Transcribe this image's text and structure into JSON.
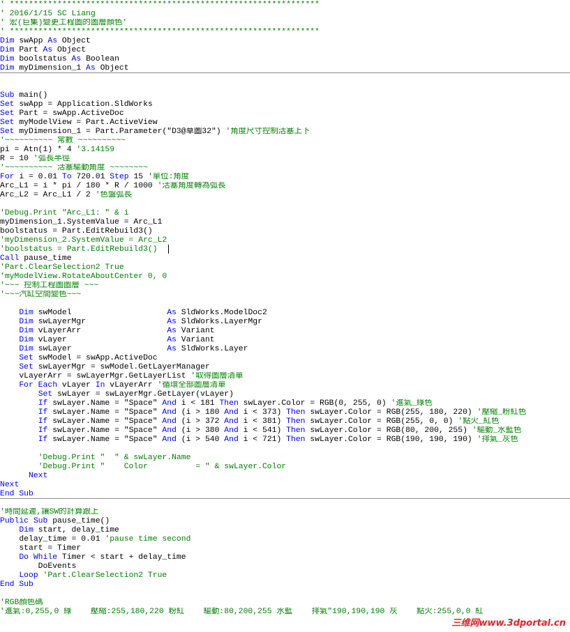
{
  "colors": {
    "keyword": "#0000ff",
    "comment": "#008000",
    "text": "#000000",
    "separator": "#8c8c8c",
    "watermark": "#e0262b"
  },
  "watermark": "三维网www.3dportal.cn",
  "lines": [
    [
      [
        "c",
        "' *****************************************************************"
      ]
    ],
    [
      [
        "c",
        "' 2016/1/15 SC Liang"
      ]
    ],
    [
      [
        "c",
        "' 宏(巨集)變更工程圖的圖層顏色'"
      ]
    ],
    [
      [
        "c",
        "' *****************************************************************"
      ]
    ],
    [
      [
        "k",
        "Dim "
      ],
      [
        "t",
        "swApp "
      ],
      [
        "k",
        "As "
      ],
      [
        "t",
        "Object"
      ]
    ],
    [
      [
        "k",
        "Dim "
      ],
      [
        "t",
        "Part "
      ],
      [
        "k",
        "As "
      ],
      [
        "t",
        "Object"
      ]
    ],
    [
      [
        "k",
        "Dim "
      ],
      [
        "t",
        "boolstatus "
      ],
      [
        "k",
        "As "
      ],
      [
        "t",
        "Boolean"
      ]
    ],
    [
      [
        "k",
        "Dim "
      ],
      [
        "t",
        "myDimension_1 "
      ],
      [
        "k",
        "As "
      ],
      [
        "t",
        "Object"
      ]
    ],
    [],
    [],
    [
      [
        "k",
        "Sub "
      ],
      [
        "t",
        "main()"
      ]
    ],
    [
      [
        "k",
        "Set "
      ],
      [
        "t",
        "swApp = Application.SldWorks"
      ]
    ],
    [
      [
        "k",
        "Set "
      ],
      [
        "t",
        "Part = swApp.ActiveDoc"
      ]
    ],
    [
      [
        "k",
        "Set "
      ],
      [
        "t",
        "myModelView = Part.ActiveView"
      ]
    ],
    [
      [
        "k",
        "Set "
      ],
      [
        "t",
        "myDimension_1 = Part.Parameter(\"D3@草圖32\") "
      ],
      [
        "c",
        "'角度尺寸控制活塞上下"
      ]
    ],
    [
      [
        "c",
        "'~~~~~~~~~~ 常數 ~~~~~~~~~~"
      ]
    ],
    [
      [
        "t",
        "pi = Atn(1) * 4 "
      ],
      [
        "c",
        "'3.14159"
      ]
    ],
    [
      [
        "t",
        "R = 10 "
      ],
      [
        "c",
        "'弧長半徑"
      ]
    ],
    [
      [
        "c",
        "'~~~~~~~~~~ 活塞驅動角度 ~~~~~~~~"
      ]
    ],
    [
      [
        "k",
        "For "
      ],
      [
        "t",
        "i = 0.01 "
      ],
      [
        "k",
        "To "
      ],
      [
        "t",
        "720.01 "
      ],
      [
        "k",
        "Step "
      ],
      [
        "t",
        "15 "
      ],
      [
        "c",
        "'單位:角度"
      ]
    ],
    [
      [
        "t",
        "Arc_L1 = i * pi / 180 * R / 1000 "
      ],
      [
        "c",
        "'活塞角度轉為弧長"
      ]
    ],
    [
      [
        "t",
        "Arc_L2 = Arc_L1 / 2 "
      ],
      [
        "c",
        "'色盤弧長"
      ]
    ],
    [],
    [
      [
        "c",
        "'Debug.Print \"Arc_L1: \" & i"
      ]
    ],
    [
      [
        "t",
        "myDimension_1.SystemValue = Arc_L1"
      ]
    ],
    [
      [
        "t",
        "boolstatus = Part.EditRebuild3()"
      ]
    ],
    [
      [
        "c",
        "'myDimension_2.SystemValue = Arc_L2"
      ]
    ],
    [
      [
        "c",
        "'boolstatus = Part.EditRebuild3()"
      ]
    ],
    [
      [
        "k",
        "Call "
      ],
      [
        "t",
        "pause_time"
      ]
    ],
    [
      [
        "c",
        "'Part.ClearSelection2 True"
      ]
    ],
    [
      [
        "c",
        "'myModelView.RotateAboutCenter 0, 0"
      ]
    ],
    [
      [
        "c",
        "'~~~ 控制工程圖圖層 ~~~"
      ]
    ],
    [
      [
        "c",
        "'~~~汽缸空間變色~~~"
      ]
    ],
    [],
    [
      [
        "t",
        "    "
      ],
      [
        "k",
        "Dim "
      ],
      [
        "t",
        "swModel                    "
      ],
      [
        "k",
        "As "
      ],
      [
        "t",
        "SldWorks.ModelDoc2"
      ]
    ],
    [
      [
        "t",
        "    "
      ],
      [
        "k",
        "Dim "
      ],
      [
        "t",
        "swLayerMgr                 "
      ],
      [
        "k",
        "As "
      ],
      [
        "t",
        "SldWorks.LayerMgr"
      ]
    ],
    [
      [
        "t",
        "    "
      ],
      [
        "k",
        "Dim "
      ],
      [
        "t",
        "vLayerArr                  "
      ],
      [
        "k",
        "As "
      ],
      [
        "t",
        "Variant"
      ]
    ],
    [
      [
        "t",
        "    "
      ],
      [
        "k",
        "Dim "
      ],
      [
        "t",
        "vLayer                     "
      ],
      [
        "k",
        "As "
      ],
      [
        "t",
        "Variant"
      ]
    ],
    [
      [
        "t",
        "    "
      ],
      [
        "k",
        "Dim "
      ],
      [
        "t",
        "swLayer                    "
      ],
      [
        "k",
        "As "
      ],
      [
        "t",
        "SldWorks.Layer"
      ]
    ],
    [
      [
        "t",
        "    "
      ],
      [
        "k",
        "Set "
      ],
      [
        "t",
        "swModel = swApp.ActiveDoc"
      ]
    ],
    [
      [
        "t",
        "    "
      ],
      [
        "k",
        "Set "
      ],
      [
        "t",
        "swLayerMgr = swModel.GetLayerManager"
      ]
    ],
    [
      [
        "t",
        "    vLayerArr = swLayerMgr.GetLayerList "
      ],
      [
        "c",
        "'取得圖層清單"
      ]
    ],
    [
      [
        "t",
        "    "
      ],
      [
        "k",
        "For Each "
      ],
      [
        "t",
        "vLayer "
      ],
      [
        "k",
        "In "
      ],
      [
        "t",
        "vLayerArr "
      ],
      [
        "c",
        "'循環全部圖層清單"
      ]
    ],
    [
      [
        "t",
        "        "
      ],
      [
        "k",
        "Set "
      ],
      [
        "t",
        "swLayer = swLayerMgr.GetLayer(vLayer)"
      ]
    ],
    [
      [
        "t",
        "        "
      ],
      [
        "k",
        "If "
      ],
      [
        "t",
        "swLayer.Name = \"Space\" "
      ],
      [
        "k",
        "And "
      ],
      [
        "t",
        "i < 181 "
      ],
      [
        "k",
        "Then "
      ],
      [
        "t",
        "swLayer.Color = RGB(0, 255, 0) "
      ],
      [
        "c",
        "'進氣_綠色"
      ]
    ],
    [
      [
        "t",
        "        "
      ],
      [
        "k",
        "If "
      ],
      [
        "t",
        "swLayer.Name = \"Space\" "
      ],
      [
        "k",
        "And "
      ],
      [
        "t",
        "(i > 180 "
      ],
      [
        "k",
        "And "
      ],
      [
        "t",
        "i < 373) "
      ],
      [
        "k",
        "Then "
      ],
      [
        "t",
        "swLayer.Color = RGB(255, 180, 220) "
      ],
      [
        "c",
        "'壓縮_粉紅色"
      ]
    ],
    [
      [
        "t",
        "        "
      ],
      [
        "k",
        "If "
      ],
      [
        "t",
        "swLayer.Name = \"Space\" "
      ],
      [
        "k",
        "And "
      ],
      [
        "t",
        "(i > 372 "
      ],
      [
        "k",
        "And "
      ],
      [
        "t",
        "i < 381) "
      ],
      [
        "k",
        "Then "
      ],
      [
        "t",
        "swLayer.Color = RGB(255, 0, 0) "
      ],
      [
        "c",
        "'點火_紅色"
      ]
    ],
    [
      [
        "t",
        "        "
      ],
      [
        "k",
        "If "
      ],
      [
        "t",
        "swLayer.Name = \"Space\" "
      ],
      [
        "k",
        "And "
      ],
      [
        "t",
        "(i > 380 "
      ],
      [
        "k",
        "And "
      ],
      [
        "t",
        "i < 541) "
      ],
      [
        "k",
        "Then "
      ],
      [
        "t",
        "swLayer.Color = RGB(80, 200, 255) "
      ],
      [
        "c",
        "'驅動_水藍色"
      ]
    ],
    [
      [
        "t",
        "        "
      ],
      [
        "k",
        "If "
      ],
      [
        "t",
        "swLayer.Name = \"Space\" "
      ],
      [
        "k",
        "And "
      ],
      [
        "t",
        "(i > 540 "
      ],
      [
        "k",
        "And "
      ],
      [
        "t",
        "i < 721) "
      ],
      [
        "k",
        "Then "
      ],
      [
        "t",
        "swLayer.Color = RGB(190, 190, 190) "
      ],
      [
        "c",
        "'排氣_灰色"
      ]
    ],
    [],
    [
      [
        "t",
        "        "
      ],
      [
        "c",
        "'Debug.Print \"  \" & swLayer.Name"
      ]
    ],
    [
      [
        "t",
        "        "
      ],
      [
        "c",
        "'Debug.Print \"    Color          = \" & swLayer.Color"
      ]
    ],
    [
      [
        "t",
        "      "
      ],
      [
        "k",
        "Next"
      ]
    ],
    [
      [
        "k",
        "Next"
      ]
    ],
    [
      [
        "k",
        "End Sub"
      ]
    ],
    [],
    [
      [
        "c",
        "'時間延遲,讓SW的計算跟上"
      ]
    ],
    [
      [
        "k",
        "Public Sub "
      ],
      [
        "t",
        "pause_time()"
      ]
    ],
    [
      [
        "t",
        "    "
      ],
      [
        "k",
        "Dim "
      ],
      [
        "t",
        "start, delay_time"
      ]
    ],
    [
      [
        "t",
        "    delay_time = 0.01 "
      ],
      [
        "c",
        "'pause time second"
      ]
    ],
    [
      [
        "t",
        "    start = Timer"
      ]
    ],
    [
      [
        "t",
        "    "
      ],
      [
        "k",
        "Do While "
      ],
      [
        "t",
        "Timer < start + delay_time"
      ]
    ],
    [
      [
        "t",
        "        DoEvents"
      ]
    ],
    [
      [
        "t",
        "    "
      ],
      [
        "k",
        "Loop "
      ],
      [
        "c",
        "'Part.ClearSelection2 True"
      ]
    ],
    [
      [
        "k",
        "End Sub"
      ]
    ],
    [],
    [
      [
        "c",
        "'RGB顏色碼"
      ]
    ],
    [
      [
        "c",
        "'進氣:0,255,0 綠    壓縮:255,180,220 粉紅    驅動:80,200,255 水藍    排氣\"190,190,190 灰    點火:255,0,0 紅"
      ]
    ]
  ]
}
